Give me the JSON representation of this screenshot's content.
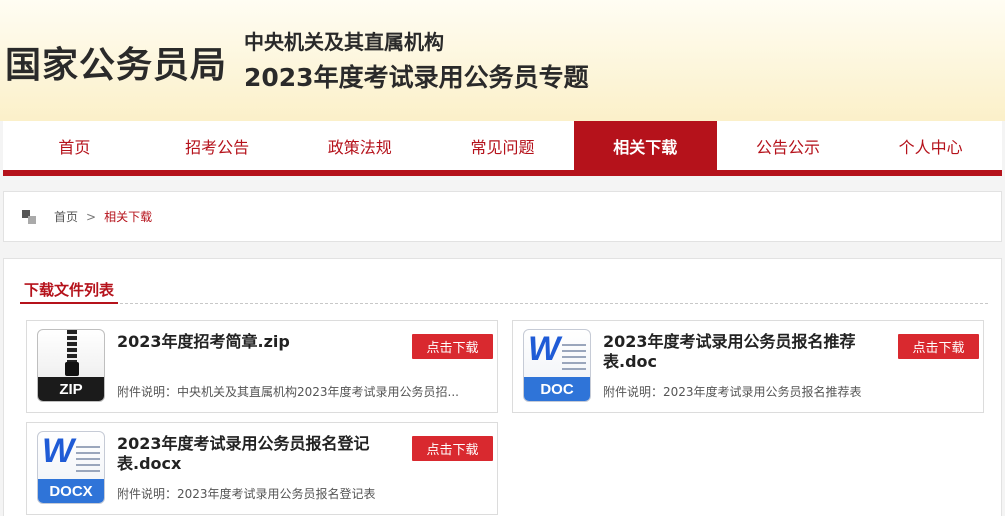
{
  "header": {
    "brand": "国家公务员局",
    "subtitle_line1": "中央机关及其直属机构",
    "subtitle_line2": "2023年度考试录用公务员专题"
  },
  "nav": {
    "items": [
      {
        "label": "首页"
      },
      {
        "label": "招考公告"
      },
      {
        "label": "政策法规"
      },
      {
        "label": "常见问题"
      },
      {
        "label": "相关下载",
        "active": true
      },
      {
        "label": "公告公示"
      },
      {
        "label": "个人中心"
      }
    ],
    "accent_color": "#b5121b"
  },
  "breadcrumb": {
    "home": "首页",
    "separator": ">",
    "current": "相关下载"
  },
  "section": {
    "title": "下载文件列表"
  },
  "files": [
    {
      "icon": "zip-file-icon",
      "icon_label": "ZIP",
      "title": "2023年度招考简章.zip",
      "description": "附件说明：中央机关及其直属机构2023年度考试录用公务员招...",
      "button": "点击下载"
    },
    {
      "icon": "word-doc-icon",
      "icon_label": "DOC",
      "title": "2023年度考试录用公务员报名推荐表.doc",
      "description": "附件说明：2023年度考试录用公务员报名推荐表",
      "button": "点击下载"
    },
    {
      "icon": "word-docx-icon",
      "icon_label": "DOCX",
      "title": "2023年度考试录用公务员报名登记表.docx",
      "description": "附件说明：2023年度考试录用公务员报名登记表",
      "button": "点击下载"
    }
  ]
}
